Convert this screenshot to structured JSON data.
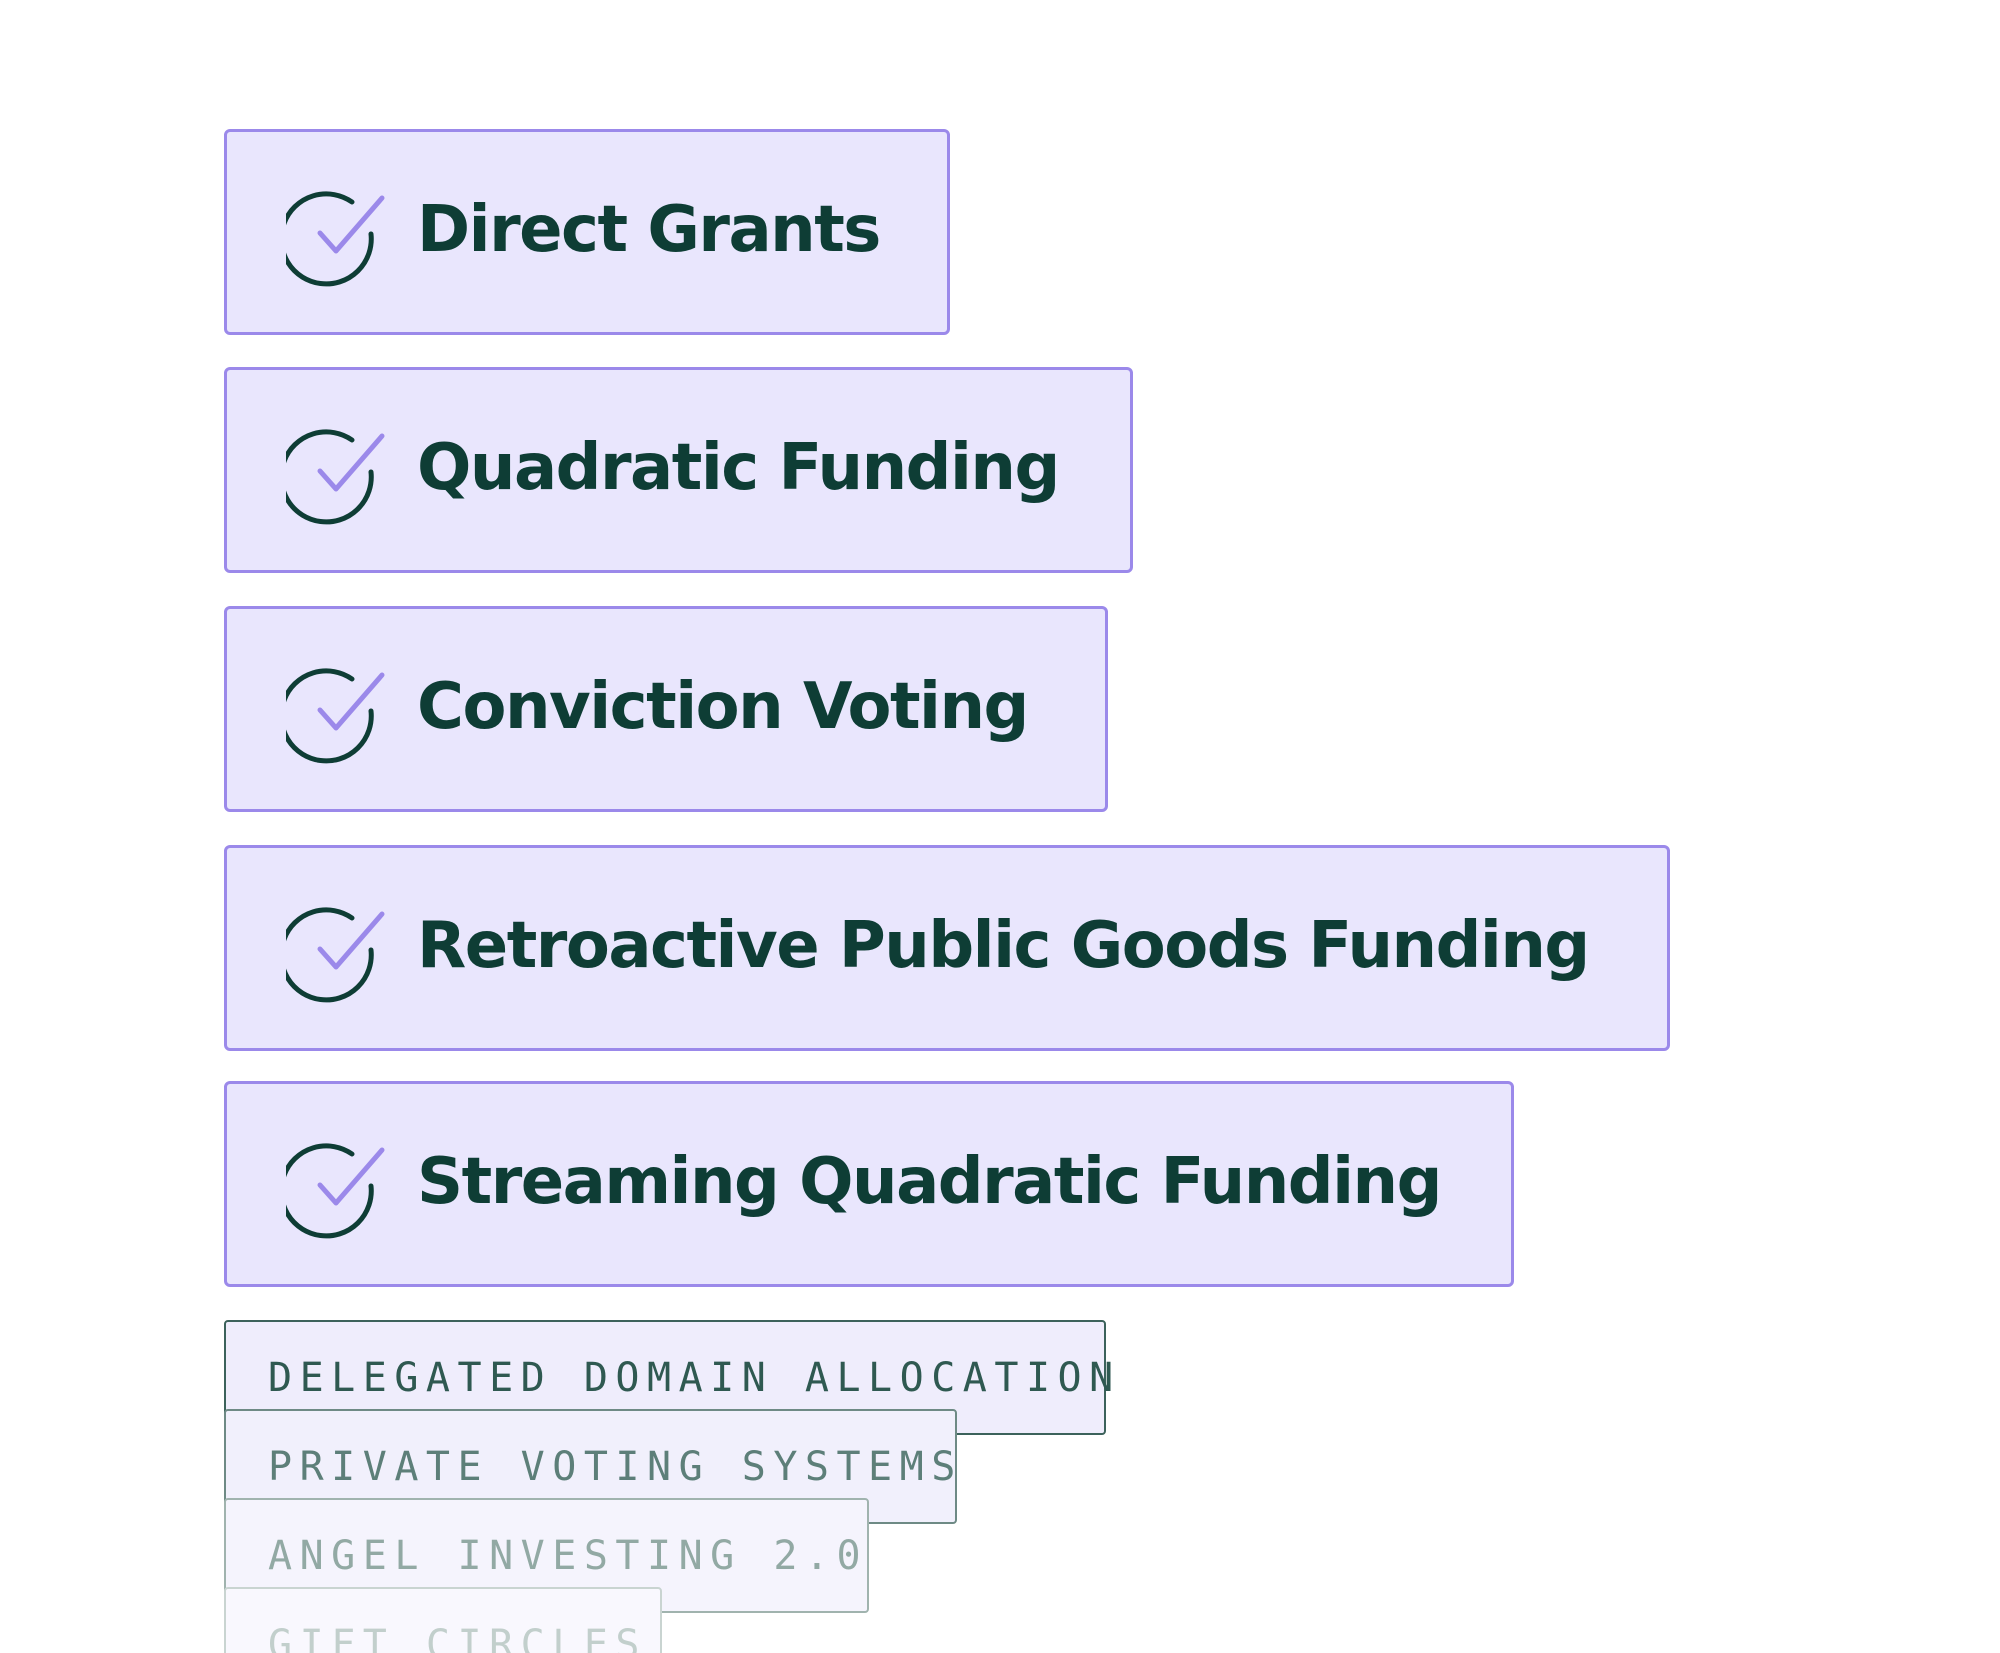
{
  "mechanisms": [
    {
      "label": "Direct Grants",
      "icon": "check-circle-icon"
    },
    {
      "label": "Quadratic Funding",
      "icon": "check-circle-icon"
    },
    {
      "label": "Conviction Voting",
      "icon": "check-circle-icon"
    },
    {
      "label": "Retroactive Public Goods Funding",
      "icon": "check-circle-icon"
    },
    {
      "label": "Streaming Quadratic Funding",
      "icon": "check-circle-icon"
    }
  ],
  "upcoming": [
    {
      "label": "DELEGATED DOMAIN ALLOCATION"
    },
    {
      "label": "PRIVATE VOTING SYSTEMS"
    },
    {
      "label": "ANGEL INVESTING 2.0"
    },
    {
      "label": "GIFT CIRCLES"
    }
  ],
  "colors": {
    "card_background": "#e9e6fd",
    "card_border": "#9b89ea",
    "text": "#0e3d35",
    "check_mark": "#9b89ea",
    "check_circle": "#0e3d35"
  }
}
